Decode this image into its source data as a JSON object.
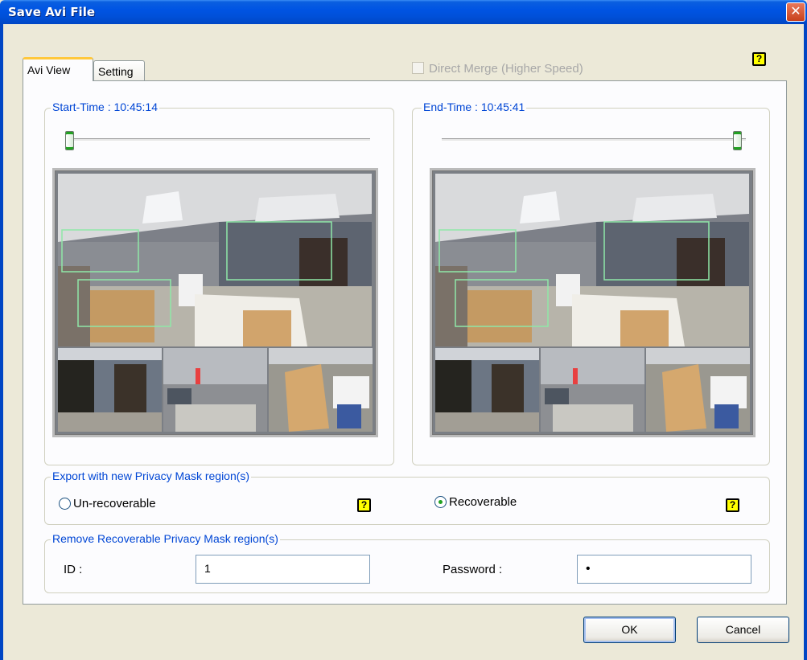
{
  "window": {
    "title": "Save Avi File",
    "close_glyph": "✕"
  },
  "tabs": [
    {
      "label": "Avi View",
      "active": true
    },
    {
      "label": "Setting",
      "active": false
    }
  ],
  "direct_merge": {
    "label": "Direct Merge (Higher Speed)",
    "checked": false,
    "enabled": false
  },
  "help_glyph": "?",
  "start": {
    "label": "Start-Time : 10:45:14",
    "slider_position": 0.0
  },
  "end": {
    "label": "End-Time : 10:45:41",
    "slider_position": 1.0
  },
  "privacy_export": {
    "legend": "Export with new Privacy Mask region(s)",
    "options": [
      {
        "label": "Un-recoverable",
        "selected": false
      },
      {
        "label": "Recoverable",
        "selected": true
      }
    ]
  },
  "remove_mask": {
    "legend": "Remove Recoverable Privacy Mask region(s)",
    "id_label": "ID :",
    "id_value": "1",
    "password_label": "Password :",
    "password_value": "•"
  },
  "buttons": {
    "ok": "OK",
    "cancel": "Cancel"
  },
  "colors": {
    "title_bar": "#0054e3",
    "legend_text": "#0046d5",
    "mask_outline": "#8fe8a8",
    "help_bg": "#ffff00"
  }
}
